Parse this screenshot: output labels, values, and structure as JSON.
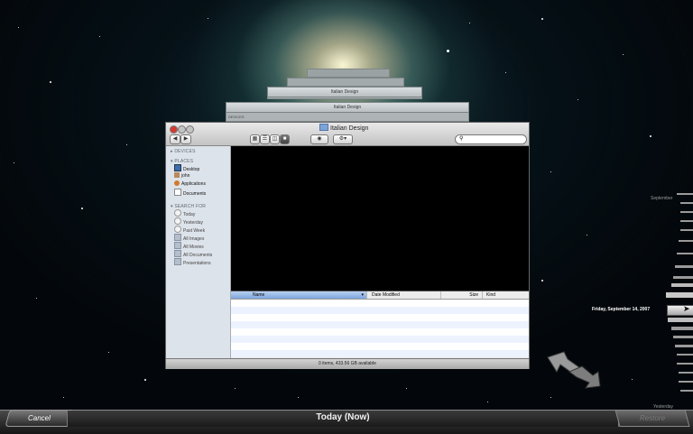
{
  "window": {
    "title": "Italian Design",
    "search_placeholder": "",
    "status": "0 items, 433.56 GB available"
  },
  "ghost_windows": [
    {
      "title": "Italian Design"
    },
    {
      "title": "Italian Design"
    }
  ],
  "ghost_sidebar_heading": "DEVICES",
  "sidebar": {
    "devices_heading": "DEVICES",
    "places_heading": "PLACES",
    "places": [
      {
        "label": "Desktop",
        "icon": "desktop-icon"
      },
      {
        "label": "john",
        "icon": "home-icon"
      },
      {
        "label": "Applications",
        "icon": "applications-icon"
      },
      {
        "label": "Documents",
        "icon": "documents-icon"
      }
    ],
    "search_heading": "SEARCH FOR",
    "searches": [
      {
        "label": "Today",
        "icon": "clock-icon"
      },
      {
        "label": "Yesterday",
        "icon": "clock-icon"
      },
      {
        "label": "Past Week",
        "icon": "clock-icon"
      },
      {
        "label": "All Images",
        "icon": "smart-folder-icon"
      },
      {
        "label": "All Movies",
        "icon": "smart-folder-icon"
      },
      {
        "label": "All Documents",
        "icon": "smart-folder-icon"
      },
      {
        "label": "Presentations",
        "icon": "smart-folder-icon"
      }
    ]
  },
  "columns": {
    "name": "Name",
    "date_modified": "Date Modified",
    "size": "Size",
    "kind": "Kind"
  },
  "timemachine": {
    "cancel": "Cancel",
    "now_label": "Today (Now)",
    "restore": "Restore",
    "timeline_month": "September",
    "selected_date": "Friday, September 14, 2007",
    "timeline_bottom": "Yesterday"
  },
  "colors": {
    "accent": "#7ea6dc",
    "close": "#d33b30"
  }
}
